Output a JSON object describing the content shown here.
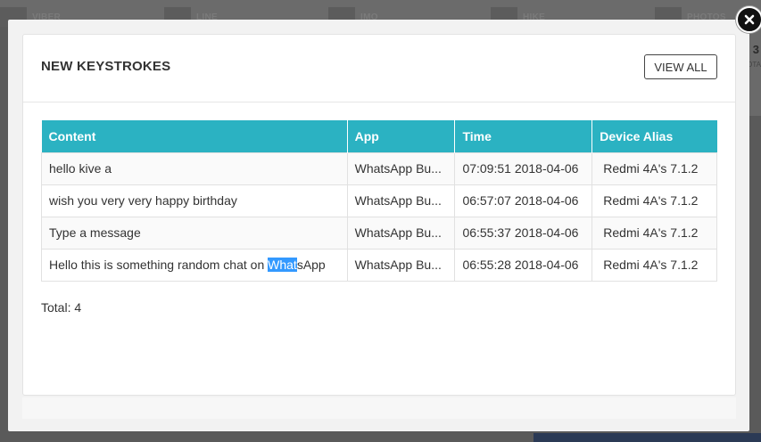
{
  "background": {
    "tabs": [
      "VIBER",
      "LINE",
      "IMO",
      "HIKE",
      "PHOTOS"
    ],
    "side_number": "3",
    "side_sub": "OTA"
  },
  "modal": {
    "title": "NEW KEYSTROKES",
    "view_all_label": "VIEW ALL",
    "close_icon": "close-icon",
    "columns": [
      "Content",
      "App",
      "Time",
      "Device Alias"
    ],
    "rows": [
      {
        "content": "hello kive a",
        "app": "WhatsApp Bu...",
        "time": "07:09:51 2018-04-06",
        "device": "Redmi 4A's 7.1.2"
      },
      {
        "content": "wish you very very happy birthday",
        "app": "WhatsApp Bu...",
        "time": "06:57:07 2018-04-06",
        "device": "Redmi 4A's 7.1.2"
      },
      {
        "content": "Type a message",
        "app": "WhatsApp Bu...",
        "time": "06:55:37 2018-04-06",
        "device": "Redmi 4A's 7.1.2"
      },
      {
        "content_before": "Hello this is something random chat on ",
        "content_selected": "What",
        "content_after": "sApp",
        "app": "WhatsApp Bu...",
        "time": "06:55:28 2018-04-06",
        "device": "Redmi 4A's 7.1.2"
      }
    ],
    "total": "Total: 4",
    "colors": {
      "header": "#2bb2c2",
      "selection": "#3399ff"
    }
  }
}
